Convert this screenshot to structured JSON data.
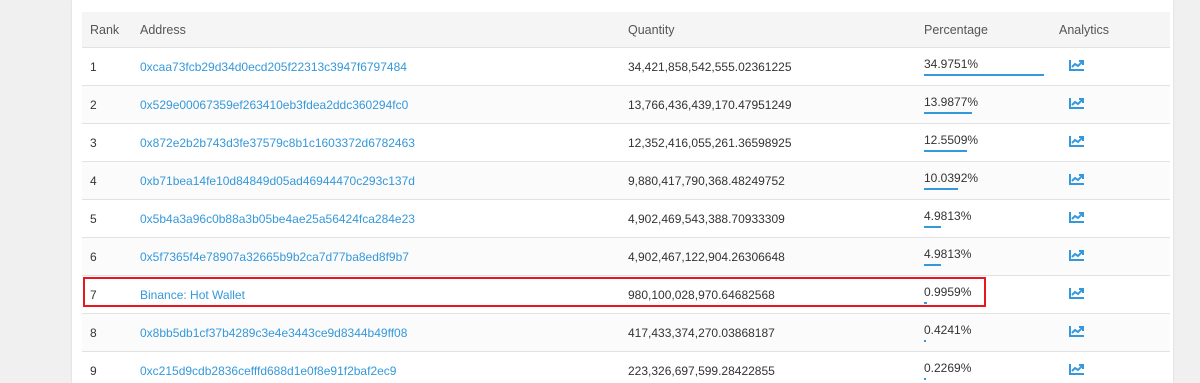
{
  "table": {
    "headers": {
      "rank": "Rank",
      "address": "Address",
      "quantity": "Quantity",
      "percentage": "Percentage",
      "analytics": "Analytics"
    },
    "rows": [
      {
        "rank": "1",
        "address": "0xcaa73fcb29d34d0ecd205f22313c3947f6797484",
        "quantity": "34,421,858,542,555.02361225",
        "percentage": "34.9751%",
        "pct_value": 34.9751
      },
      {
        "rank": "2",
        "address": "0x529e00067359ef263410eb3fdea2ddc360294fc0",
        "quantity": "13,766,436,439,170.47951249",
        "percentage": "13.9877%",
        "pct_value": 13.9877
      },
      {
        "rank": "3",
        "address": "0x872e2b2b743d3fe37579c8b1c1603372d6782463",
        "quantity": "12,352,416,055,261.36598925",
        "percentage": "12.5509%",
        "pct_value": 12.5509
      },
      {
        "rank": "4",
        "address": "0xb71bea14fe10d84849d05ad46944470c293c137d",
        "quantity": "9,880,417,790,368.48249752",
        "percentage": "10.0392%",
        "pct_value": 10.0392
      },
      {
        "rank": "5",
        "address": "0x5b4a3a96c0b88a3b05be4ae25a56424fca284e23",
        "quantity": "4,902,469,543,388.70933309",
        "percentage": "4.9813%",
        "pct_value": 4.9813
      },
      {
        "rank": "6",
        "address": "0x5f7365f4e78907a32665b9b2ca7d77ba8ed8f9b7",
        "quantity": "4,902,467,122,904.26306648",
        "percentage": "4.9813%",
        "pct_value": 4.9813
      },
      {
        "rank": "7",
        "address": "Binance: Hot Wallet",
        "quantity": "980,100,028,970.64682568",
        "percentage": "0.9959%",
        "pct_value": 0.9959
      },
      {
        "rank": "8",
        "address": "0x8bb5db1cf37b4289c3e4e3443ce9d8344b49ff08",
        "quantity": "417,433,374,270.03868187",
        "percentage": "0.4241%",
        "pct_value": 0.4241
      },
      {
        "rank": "9",
        "address": "0xc215d9cdb2836cefffd688d1e0f8e91f2baf2ec9",
        "quantity": "223,326,697,599.28422855",
        "percentage": "0.2269%",
        "pct_value": 0.2269
      }
    ],
    "analytics_icon": "chart-line-icon",
    "highlighted_rank": "7"
  },
  "colors": {
    "link": "#3498db",
    "bar": "#3498db",
    "highlight": "#e8171d",
    "header_bg": "#f5f5f5"
  }
}
